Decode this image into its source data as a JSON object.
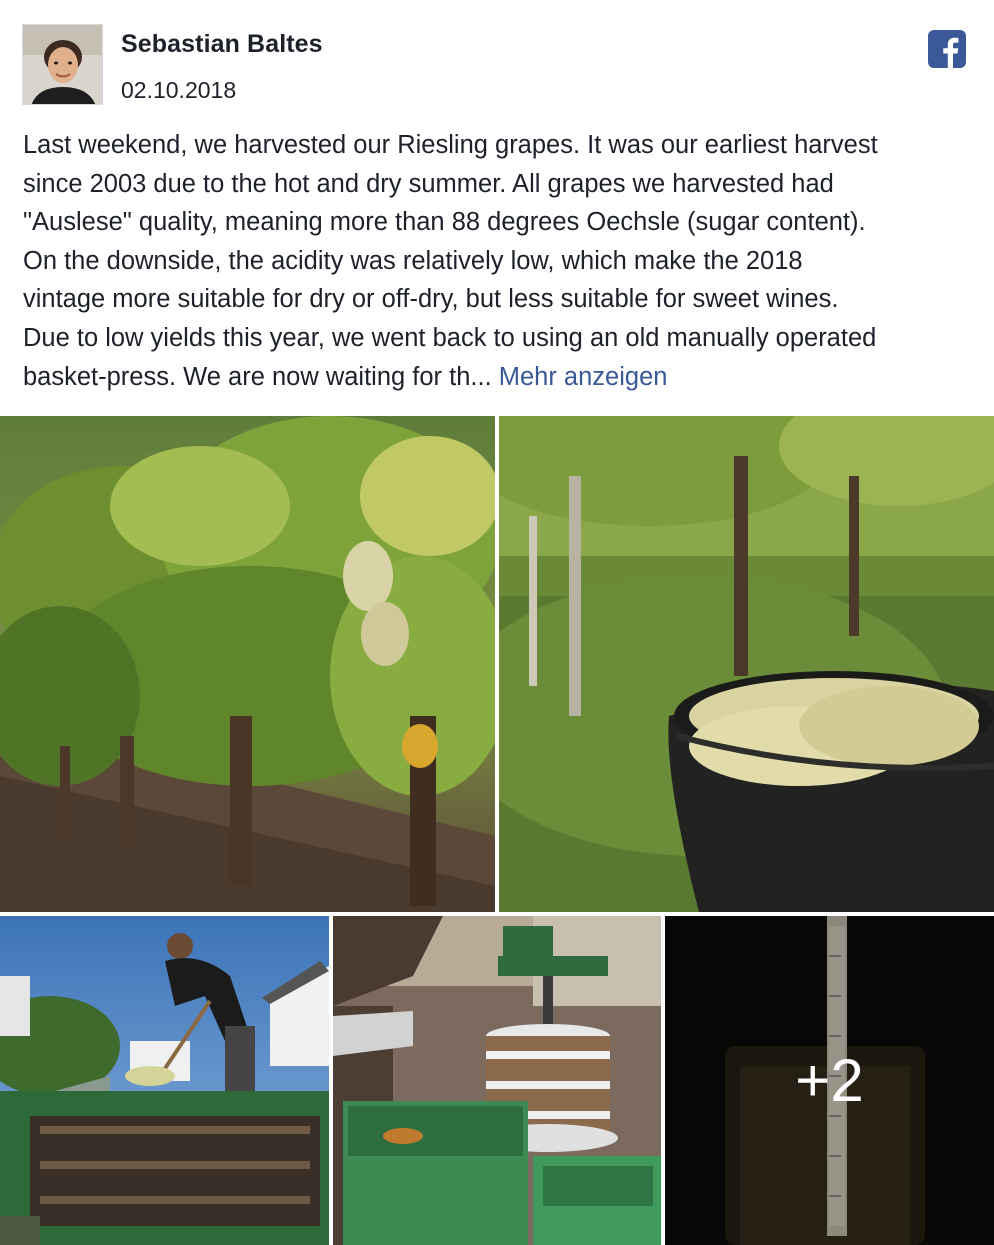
{
  "post": {
    "author_name": "Sebastian Baltes",
    "date": "02.10.2018",
    "text_lines": [
      "Last weekend, we harvested our Riesling grapes. It was our earliest harvest",
      "since 2003 due to the hot and dry summer. All grapes we harvested had",
      "\"Auslese\" quality, meaning more than 88 degrees Oechsle (sugar content).",
      "On the downside, the acidity was relatively low, which make the 2018",
      "vintage more suitable for dry or off-dry, but less suitable for sweet wines.",
      "Due to low yields this year, we went back to using an old manually operated",
      "basket-press. We are now waiting for th..."
    ],
    "more_link": "Mehr anzeigen"
  },
  "icons": {
    "avatar": "avatar-photo",
    "facebook": "facebook-icon"
  },
  "colors": {
    "link": "#385898",
    "facebook_brand": "#3b5998",
    "text": "#1d2129"
  },
  "gallery": {
    "photos": [
      {
        "name": "vineyard-grape-cluster-photo"
      },
      {
        "name": "grape-bucket-photo"
      },
      {
        "name": "harvester-unloading-photo"
      },
      {
        "name": "basket-press-photo"
      },
      {
        "name": "refractometer-photo"
      }
    ],
    "more_count": "+2"
  }
}
